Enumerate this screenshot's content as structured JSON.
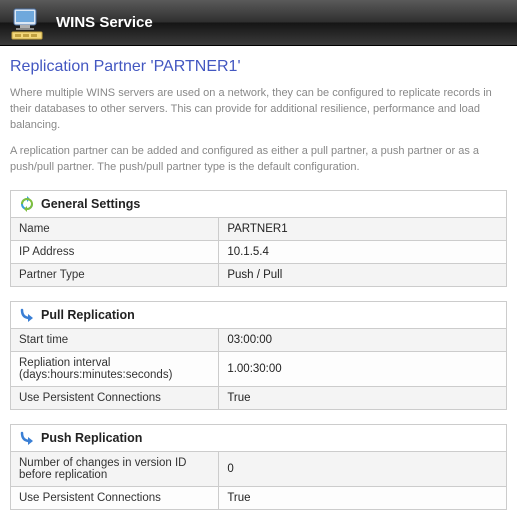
{
  "header": {
    "title": "WINS Service"
  },
  "page": {
    "title": "Replication Partner 'PARTNER1'",
    "intro1": "Where multiple WINS servers are used on a network, they can be configured to replicate records in their databases to other servers. This can provide for additional resilience, performance and load balancing.",
    "intro2": "A replication partner can be added and configured as either a pull partner, a push partner or as a push/pull partner. The push/pull partner type is the default configuration."
  },
  "sections": {
    "general": {
      "title": "General Settings",
      "rows": [
        {
          "label": "Name",
          "value": "PARTNER1"
        },
        {
          "label": "IP Address",
          "value": "10.1.5.4"
        },
        {
          "label": "Partner Type",
          "value": "Push / Pull"
        }
      ]
    },
    "pull": {
      "title": "Pull Replication",
      "rows": [
        {
          "label": "Start time",
          "value": "03:00:00"
        },
        {
          "label": "Repliation interval (days:hours:minutes:seconds)",
          "value": "1.00:30:00"
        },
        {
          "label": "Use Persistent Connections",
          "value": "True"
        }
      ]
    },
    "push": {
      "title": "Push Replication",
      "rows": [
        {
          "label": "Number of changes in version ID before replication",
          "value": "0"
        },
        {
          "label": "Use Persistent Connections",
          "value": "True"
        }
      ]
    }
  }
}
